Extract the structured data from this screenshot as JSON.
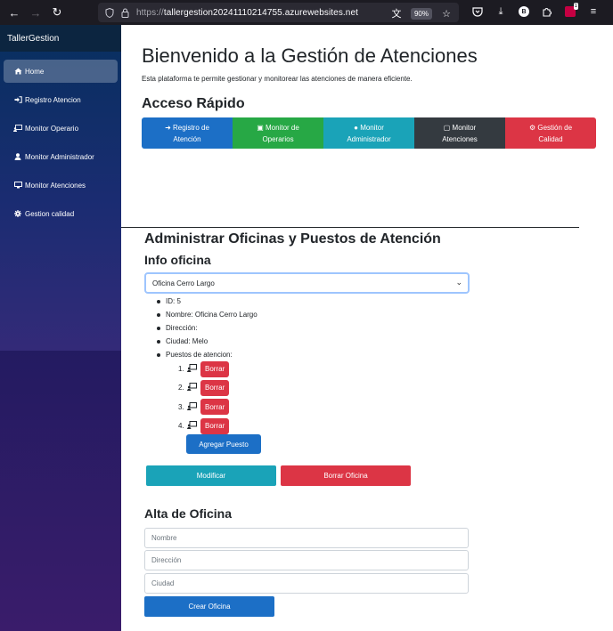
{
  "browser": {
    "url_main": "tallergestion20241110214755.azurewebsites.net",
    "url_prefix": "https://",
    "zoom": "90%"
  },
  "sidebar": {
    "brand": "TallerGestion",
    "items": [
      {
        "label": "Home",
        "icon": "home-icon"
      },
      {
        "label": "Registro Atencion",
        "icon": "sign-in-icon"
      },
      {
        "label": "Monitor Operario",
        "icon": "monitor-users-icon"
      },
      {
        "label": "Monitor Administrador",
        "icon": "user-icon"
      },
      {
        "label": "Monitor Atenciones",
        "icon": "desktop-icon"
      },
      {
        "label": "Gestion calidad",
        "icon": "gear-icon"
      }
    ]
  },
  "header": {
    "title": "Bienvenido a la Gestión de Atenciones",
    "subtitle": "Esta plataforma te permite gestionar y monitorear las atenciones de manera eficiente."
  },
  "quick_access": {
    "title": "Acceso Rápido",
    "buttons": [
      {
        "line1": "Registro de",
        "line2": "Atención",
        "icon": "sign-in-icon",
        "color": "#1c6fc6"
      },
      {
        "line1": "Monitor de",
        "line2": "Operarios",
        "icon": "monitor-users-icon",
        "color": "#27a845"
      },
      {
        "line1": "Monitor",
        "line2": "Administrador",
        "icon": "user-icon",
        "color": "#1aa3b8"
      },
      {
        "line1": "Monitor",
        "line2": "Atenciones",
        "icon": "desktop-icon",
        "color": "#343a40"
      },
      {
        "line1": "Gestión de",
        "line2": "Calidad",
        "icon": "gear-icon",
        "color": "#dc3545"
      }
    ]
  },
  "admin": {
    "title": "Administrar Oficinas y Puestos de Atención",
    "info_title": "Info oficina",
    "selected_office": "Oficina Cerro Largo",
    "info": {
      "id": "ID: 5",
      "nombre": "Nombre: Oficina Cerro Largo",
      "direccion": "Dirección:",
      "ciudad": "Ciudad: Melo",
      "puestos_label": "Puestos de atencion:"
    },
    "puestos": [
      {
        "num": "1.",
        "delete_label": "Borrar"
      },
      {
        "num": "2.",
        "delete_label": "Borrar"
      },
      {
        "num": "3.",
        "delete_label": "Borrar"
      },
      {
        "num": "4.",
        "delete_label": "Borrar"
      }
    ],
    "add_puesto_label": "Agregar Puesto",
    "modify_label": "Modificar",
    "delete_office_label": "Borrar Oficina"
  },
  "alta": {
    "title": "Alta de Oficina",
    "nombre_placeholder": "Nombre",
    "direccion_placeholder": "Dirección",
    "ciudad_placeholder": "Ciudad",
    "create_label": "Crear Oficina"
  }
}
